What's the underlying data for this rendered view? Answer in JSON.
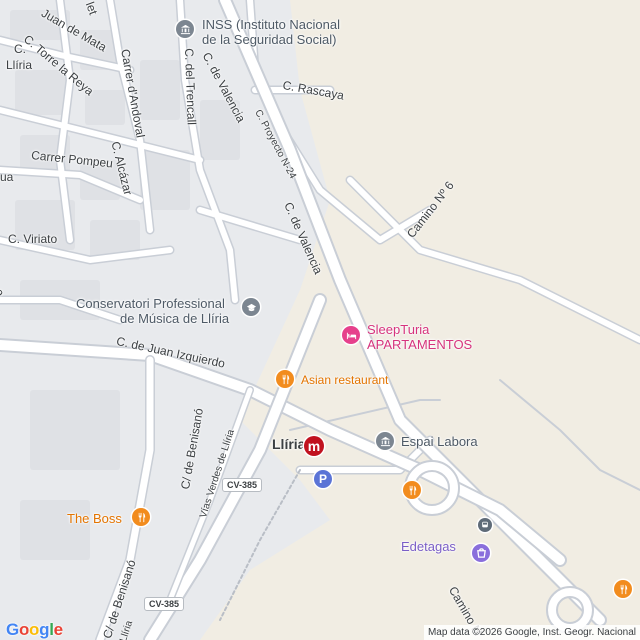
{
  "map": {
    "streets": {
      "inss_like_top": "C. de Valencia",
      "c_de_valencia_lower": "C. de Valencia",
      "c_del_trencall": "C. del Trencall",
      "carrer_dandoval": "Carrer d'Andoval",
      "c_rascaya": "C. Rascaya",
      "c_proyecto": "C. Proyecto N-24",
      "camino_6": "Camino Nº 6",
      "carrer_pompeu": "Carrer Pompeu",
      "c_alcazar": "C. Alcázar",
      "c_viriato": "C. Viriato",
      "c_juan_izquierdo": "C. de Juan Izquierdo",
      "c_benisano_upper": "C/ de Benisanó",
      "c_benisano_lower": "C/ de Benisanó",
      "vias_verdes": "Vías Verdes de Llíria",
      "c_torre_la_reya": "C. Torre la Reya",
      "c_lliria": "Llíria",
      "juan_de_mata": "Juan de Mata",
      "c_top_left": "C.",
      "let_fragment": "let",
      "ua_fragment": "ua",
      "o_fragment": "o",
      "camino_lower": "Camino M",
      "vias_lower": "Llíria"
    },
    "pois": {
      "inss_line1": "INSS (Instituto Nacional",
      "inss_line2": "de la Seguridad Social)",
      "conservatori_line1": "Conservatori Professional",
      "conservatori_line2": "de Música de Llíria",
      "sleepturia_line1": "SleepTuria",
      "sleepturia_line2": "APARTAMENTOS",
      "asian_restaurant": "Asian restaurant",
      "espai_labora": "Espai Labora",
      "the_boss": "The Boss",
      "edetagas": "Edetagas",
      "lliria_station": "Llíria"
    },
    "shields": {
      "cv385_a": "CV-385",
      "cv385_b": "CV-385"
    },
    "icons": {
      "metro": "m",
      "parking": "P"
    },
    "colors": {
      "background": "#e8eaed",
      "open_area": "#f1ede3",
      "road": "#ffffff",
      "road_outline": "#c9ced6",
      "poi_orange": "#f28c1e",
      "poi_pink": "#e6408c",
      "poi_gray": "#7c8691",
      "metro_red": "#c1121f"
    }
  },
  "branding": {
    "logo": "Google",
    "attribution": "Map data ©2026 Google, Inst. Geogr. Nacional"
  }
}
